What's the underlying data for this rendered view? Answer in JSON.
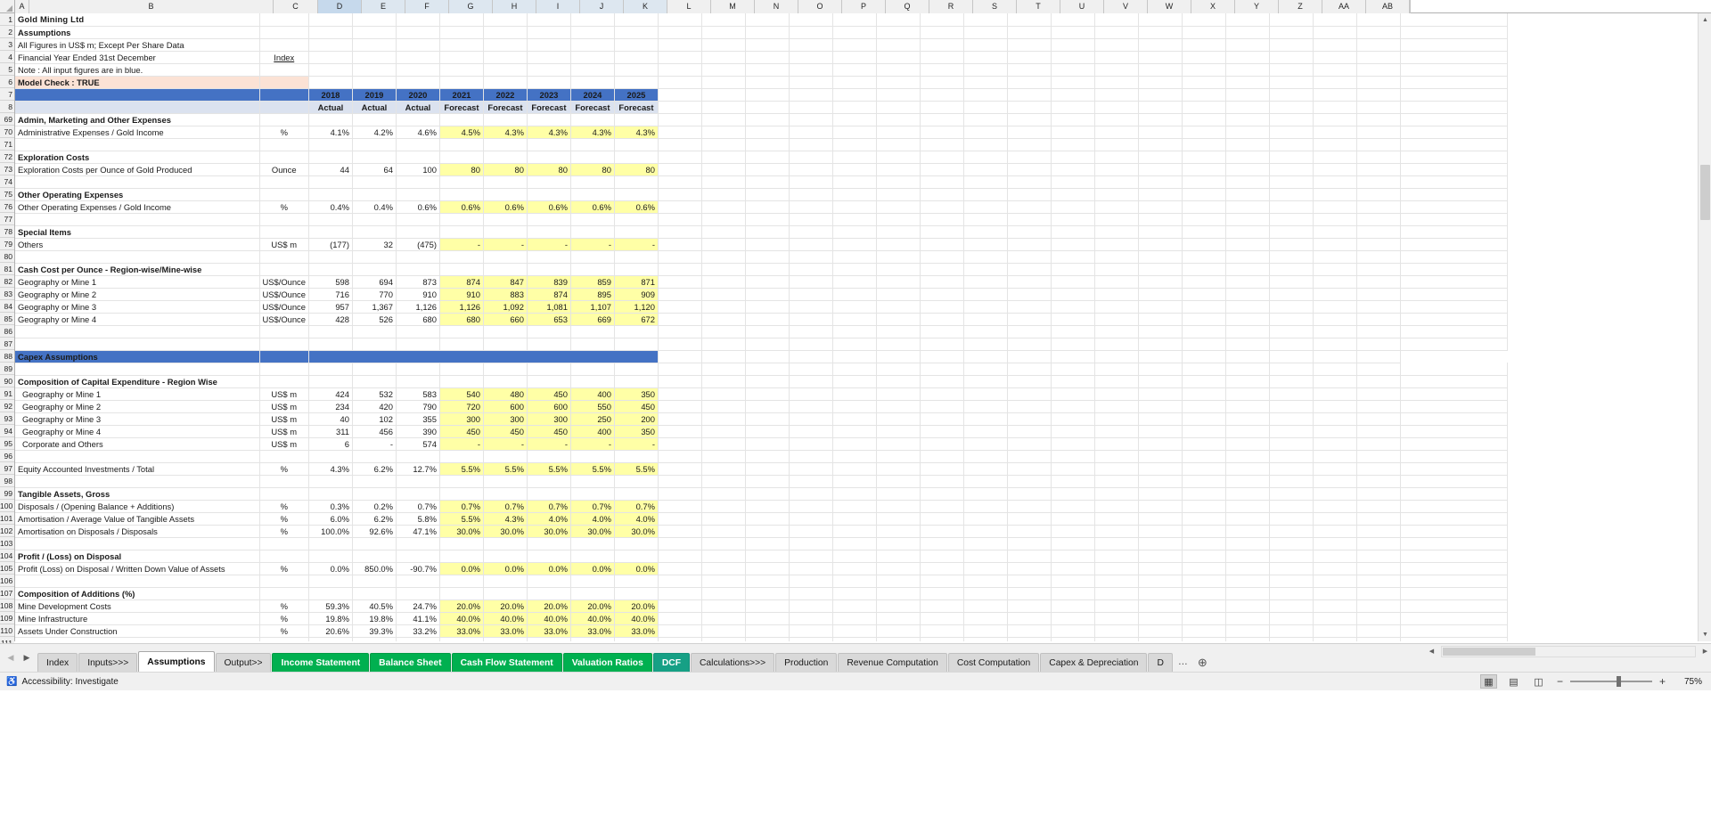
{
  "app": {
    "sheet_name": "Assumptions"
  },
  "columns": [
    "A",
    "B",
    "C",
    "D",
    "E",
    "F",
    "G",
    "H",
    "I",
    "J",
    "K",
    "L",
    "M",
    "N",
    "O",
    "P",
    "Q",
    "R",
    "S",
    "T",
    "U",
    "V",
    "W",
    "X",
    "Y",
    "Z",
    "AA",
    "AB"
  ],
  "header": {
    "company": "Gold Mining Ltd",
    "subtitle": "Assumptions",
    "note1": "All Figures in US$ m; Except Per Share Data",
    "note2": "Financial Year Ended 31st December",
    "index_link": "Index",
    "note3": "Note :  All input figures are in blue.",
    "model_check": "Model Check : TRUE"
  },
  "year_header": {
    "years": [
      "2018",
      "2019",
      "2020",
      "2021",
      "2022",
      "2023",
      "2024",
      "2025"
    ],
    "types": [
      "Actual",
      "Actual",
      "Actual",
      "Forecast",
      "Forecast",
      "Forecast",
      "Forecast",
      "Forecast"
    ]
  },
  "capex_banner": "Capex Assumptions",
  "rows": [
    {
      "n": 69,
      "label": "Admin, Marketing and Other Expenses",
      "kind": "section"
    },
    {
      "n": 70,
      "label": "Administrative Expenses / Gold Income",
      "unit": "%",
      "kind": "data",
      "actual": [
        "4.1%",
        "4.2%",
        "4.6%"
      ],
      "forecast": [
        "4.5%",
        "4.3%",
        "4.3%",
        "4.3%",
        "4.3%"
      ]
    },
    {
      "n": 71,
      "kind": "blank"
    },
    {
      "n": 72,
      "label": "Exploration Costs",
      "kind": "section"
    },
    {
      "n": 73,
      "label": "Exploration Costs per Ounce of Gold Produced",
      "unit": "Ounce",
      "kind": "data",
      "actual": [
        "44",
        "64",
        "100"
      ],
      "forecast": [
        "80",
        "80",
        "80",
        "80",
        "80"
      ]
    },
    {
      "n": 74,
      "kind": "blank"
    },
    {
      "n": 75,
      "label": "Other Operating Expenses",
      "kind": "section"
    },
    {
      "n": 76,
      "label": "Other Operating Expenses / Gold Income",
      "unit": "%",
      "kind": "data",
      "actual": [
        "0.4%",
        "0.4%",
        "0.6%"
      ],
      "forecast": [
        "0.6%",
        "0.6%",
        "0.6%",
        "0.6%",
        "0.6%"
      ]
    },
    {
      "n": 77,
      "kind": "blank"
    },
    {
      "n": 78,
      "label": "Special Items",
      "kind": "section"
    },
    {
      "n": 79,
      "label": "Others",
      "unit": "US$ m",
      "kind": "data",
      "actual": [
        "(177)",
        "32",
        "(475)"
      ],
      "forecast": [
        "-",
        "-",
        "-",
        "-",
        "-"
      ]
    },
    {
      "n": 80,
      "kind": "blank"
    },
    {
      "n": 81,
      "label": "Cash Cost per Ounce - Region-wise/Mine-wise",
      "kind": "section"
    },
    {
      "n": 82,
      "label": "Geography or Mine 1",
      "unit": "US$/Ounce",
      "kind": "data",
      "actual": [
        "598",
        "694",
        "873"
      ],
      "forecast": [
        "874",
        "847",
        "839",
        "859",
        "871"
      ]
    },
    {
      "n": 83,
      "label": "Geography or Mine 2",
      "unit": "US$/Ounce",
      "kind": "data",
      "actual": [
        "716",
        "770",
        "910"
      ],
      "forecast": [
        "910",
        "883",
        "874",
        "895",
        "909"
      ]
    },
    {
      "n": 84,
      "label": "Geography or Mine 3",
      "unit": "US$/Ounce",
      "kind": "data",
      "actual": [
        "957",
        "1,367",
        "1,126"
      ],
      "forecast": [
        "1,126",
        "1,092",
        "1,081",
        "1,107",
        "1,120"
      ]
    },
    {
      "n": 85,
      "label": "Geography or Mine 4",
      "unit": "US$/Ounce",
      "kind": "data",
      "actual": [
        "428",
        "526",
        "680"
      ],
      "forecast": [
        "680",
        "660",
        "653",
        "669",
        "672"
      ]
    },
    {
      "n": 86,
      "kind": "blank"
    },
    {
      "n": 87,
      "kind": "blank"
    },
    {
      "n": 88,
      "kind": "banner"
    },
    {
      "n": 89,
      "kind": "blank"
    },
    {
      "n": 90,
      "label": "Composition of Capital Expenditure - Region Wise",
      "kind": "section"
    },
    {
      "n": 91,
      "label": "Geography or Mine 1",
      "unit": "US$ m",
      "kind": "data",
      "indent": true,
      "actual": [
        "424",
        "532",
        "583"
      ],
      "forecast": [
        "540",
        "480",
        "450",
        "400",
        "350"
      ]
    },
    {
      "n": 92,
      "label": "Geography or Mine 2",
      "unit": "US$ m",
      "kind": "data",
      "indent": true,
      "actual": [
        "234",
        "420",
        "790"
      ],
      "forecast": [
        "720",
        "600",
        "600",
        "550",
        "450"
      ]
    },
    {
      "n": 93,
      "label": "Geography or Mine 3",
      "unit": "US$ m",
      "kind": "data",
      "indent": true,
      "actual": [
        "40",
        "102",
        "355"
      ],
      "forecast": [
        "300",
        "300",
        "300",
        "250",
        "200"
      ]
    },
    {
      "n": 94,
      "label": "Geography or Mine 4",
      "unit": "US$ m",
      "kind": "data",
      "indent": true,
      "actual": [
        "311",
        "456",
        "390"
      ],
      "forecast": [
        "450",
        "450",
        "450",
        "400",
        "350"
      ]
    },
    {
      "n": 95,
      "label": "Corporate and Others",
      "unit": "US$ m",
      "kind": "data",
      "indent": true,
      "actual": [
        "6",
        "-",
        "574"
      ],
      "forecast": [
        "-",
        "-",
        "-",
        "-",
        "-"
      ]
    },
    {
      "n": 96,
      "kind": "blank"
    },
    {
      "n": 97,
      "label": "Equity Accounted Investments / Total",
      "unit": "%",
      "kind": "data",
      "actual": [
        "4.3%",
        "6.2%",
        "12.7%"
      ],
      "forecast": [
        "5.5%",
        "5.5%",
        "5.5%",
        "5.5%",
        "5.5%"
      ]
    },
    {
      "n": 98,
      "kind": "blank"
    },
    {
      "n": 99,
      "label": "Tangible Assets, Gross",
      "kind": "section"
    },
    {
      "n": 100,
      "label": "Disposals / (Opening Balance + Additions)",
      "unit": "%",
      "kind": "data",
      "actual": [
        "0.3%",
        "0.2%",
        "0.7%"
      ],
      "forecast": [
        "0.7%",
        "0.7%",
        "0.7%",
        "0.7%",
        "0.7%"
      ]
    },
    {
      "n": 101,
      "label": "Amortisation / Average Value of Tangible Assets",
      "unit": "%",
      "kind": "data",
      "actual": [
        "6.0%",
        "6.2%",
        "5.8%"
      ],
      "forecast": [
        "5.5%",
        "4.3%",
        "4.0%",
        "4.0%",
        "4.0%"
      ]
    },
    {
      "n": 102,
      "label": "Amortisation on Disposals / Disposals",
      "unit": "%",
      "kind": "data",
      "actual": [
        "100.0%",
        "92.6%",
        "47.1%"
      ],
      "forecast": [
        "30.0%",
        "30.0%",
        "30.0%",
        "30.0%",
        "30.0%"
      ]
    },
    {
      "n": 103,
      "kind": "blank"
    },
    {
      "n": 104,
      "label": "Profit / (Loss) on Disposal",
      "kind": "section"
    },
    {
      "n": 105,
      "label": "Profit (Loss) on Disposal / Written Down Value of Assets",
      "unit": "%",
      "kind": "data",
      "actual": [
        "0.0%",
        "850.0%",
        "-90.7%"
      ],
      "forecast": [
        "0.0%",
        "0.0%",
        "0.0%",
        "0.0%",
        "0.0%"
      ]
    },
    {
      "n": 106,
      "kind": "blank"
    },
    {
      "n": 107,
      "label": "Composition of Additions (%)",
      "kind": "section"
    },
    {
      "n": 108,
      "label": "Mine Development Costs",
      "unit": "%",
      "kind": "data",
      "actual": [
        "59.3%",
        "40.5%",
        "24.7%"
      ],
      "forecast": [
        "20.0%",
        "20.0%",
        "20.0%",
        "20.0%",
        "20.0%"
      ]
    },
    {
      "n": 109,
      "label": "Mine Infrastructure",
      "unit": "%",
      "kind": "data",
      "actual": [
        "19.8%",
        "19.8%",
        "41.1%"
      ],
      "forecast": [
        "40.0%",
        "40.0%",
        "40.0%",
        "40.0%",
        "40.0%"
      ]
    },
    {
      "n": 110,
      "label": "Assets Under Construction",
      "unit": "%",
      "kind": "data",
      "actual": [
        "20.6%",
        "39.3%",
        "33.2%"
      ],
      "forecast": [
        "33.0%",
        "33.0%",
        "33.0%",
        "33.0%",
        "33.0%"
      ]
    },
    {
      "n": 111,
      "kind": "blank"
    }
  ],
  "sheet_tabs": [
    {
      "label": "Index",
      "style": "grey",
      "active": false
    },
    {
      "label": "Inputs>>>",
      "style": "grey",
      "active": false
    },
    {
      "label": "Assumptions",
      "style": "white",
      "active": true
    },
    {
      "label": "Output>>",
      "style": "grey",
      "active": false
    },
    {
      "label": "Income Statement",
      "style": "green",
      "active": false
    },
    {
      "label": "Balance Sheet",
      "style": "green",
      "active": false
    },
    {
      "label": "Cash Flow Statement",
      "style": "green",
      "active": false
    },
    {
      "label": "Valuation Ratios",
      "style": "green",
      "active": false
    },
    {
      "label": "DCF",
      "style": "teal",
      "active": false
    },
    {
      "label": "Calculations>>>",
      "style": "grey",
      "active": false
    },
    {
      "label": "Production",
      "style": "grey",
      "active": false
    },
    {
      "label": "Revenue Computation",
      "style": "grey",
      "active": false
    },
    {
      "label": "Cost Computation",
      "style": "grey",
      "active": false
    },
    {
      "label": "Capex & Depreciation",
      "style": "grey",
      "active": false
    },
    {
      "label": "D",
      "style": "grey",
      "active": false
    }
  ],
  "tab_overflow": "…",
  "add_sheet_icon": "plus-circle-icon",
  "status": {
    "accessibility": "Accessibility: Investigate",
    "zoom": "75%",
    "zoom_out": "−",
    "zoom_in": "+"
  }
}
